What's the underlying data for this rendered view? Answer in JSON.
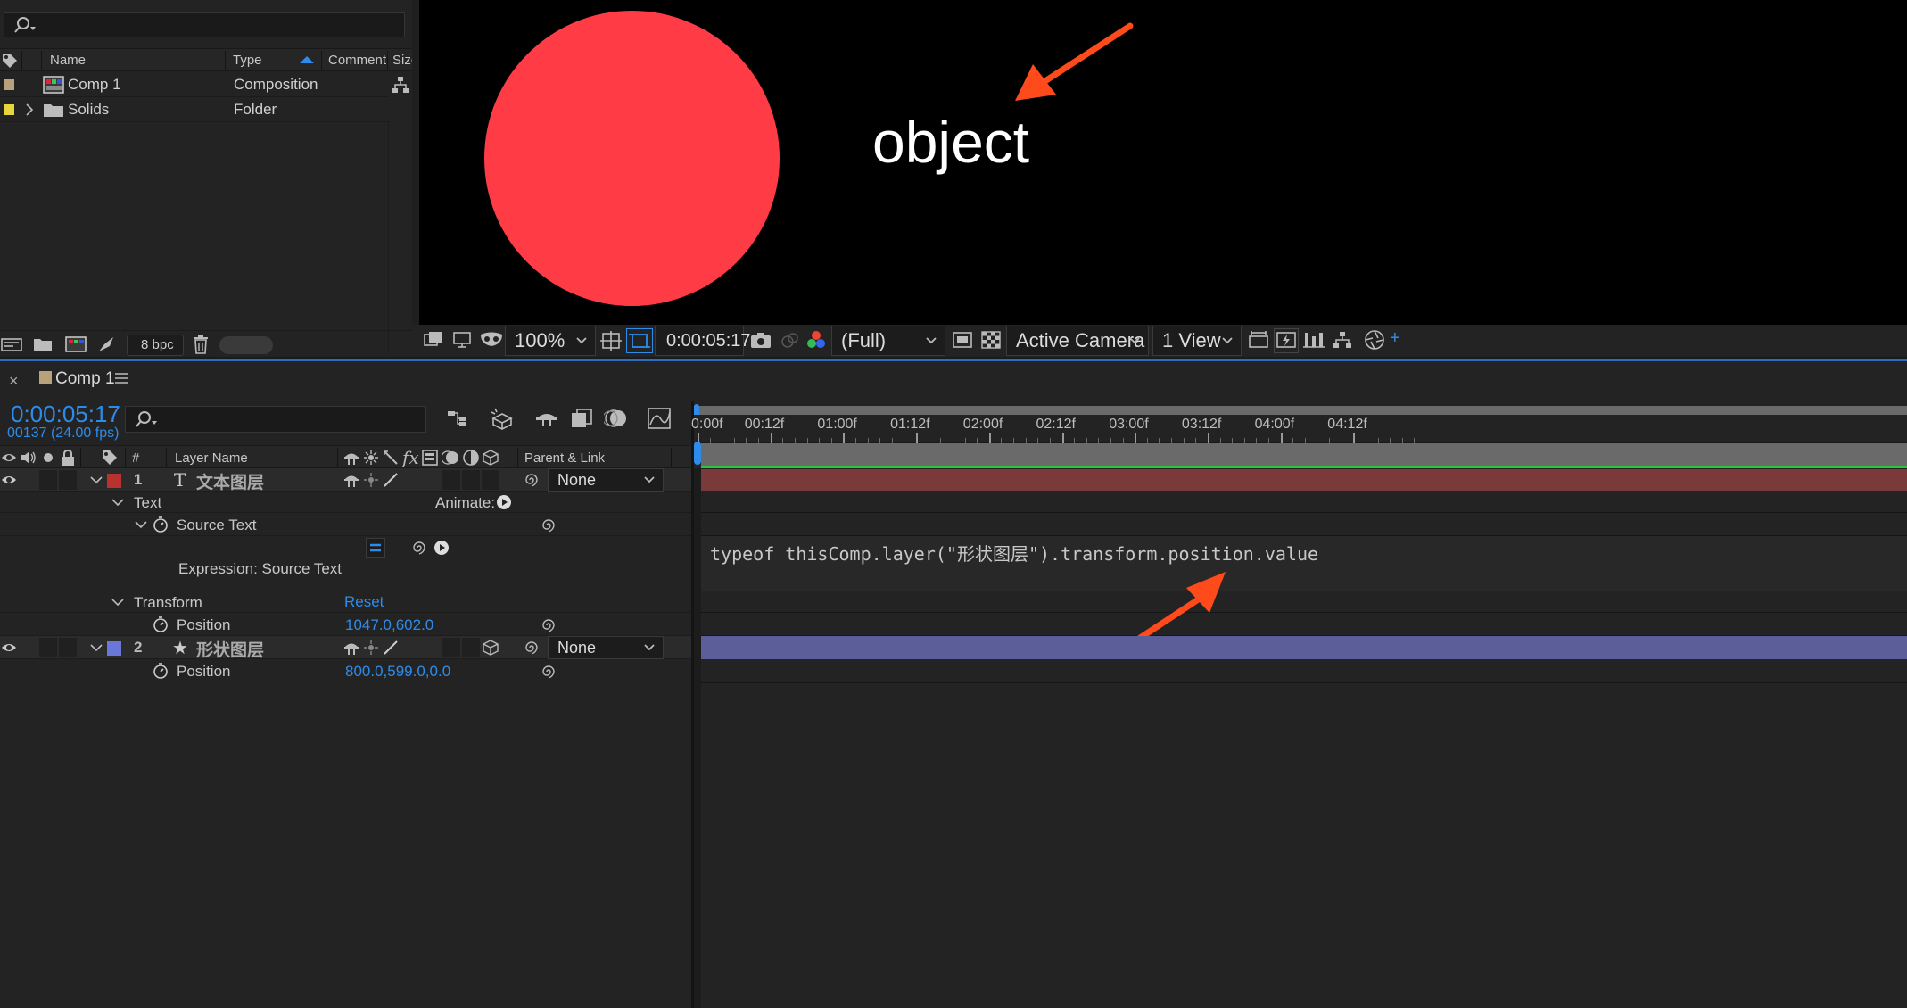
{
  "project": {
    "search_placeholder": "",
    "columns": {
      "name": "Name",
      "type": "Type",
      "comment": "Comment",
      "size": "Size"
    },
    "items": [
      {
        "name": "Comp 1",
        "type": "Composition",
        "label_color": "#b8a27c"
      },
      {
        "name": "Solids",
        "type": "Folder",
        "label_color": "#e6d83c"
      }
    ],
    "bpc": "8 bpc"
  },
  "viewer": {
    "circle_color": "#ff3c46",
    "arrow_color": "#ff4a1c",
    "overlay_text": "object",
    "zoom": "100%",
    "timecode": "0:00:05:17",
    "resolution": "(Full)",
    "camera": "Active Camera",
    "views": "1 View"
  },
  "timeline": {
    "tab_title": "Comp 1",
    "current_time": "0:00:05:17",
    "frame_info": "00137 (24.00 fps)",
    "search_placeholder": "",
    "col_hash": "#",
    "col_layer_name": "Layer Name",
    "col_parent": "Parent & Link",
    "ruler": [
      "0:00f",
      "00:12f",
      "01:00f",
      "01:12f",
      "02:00f",
      "02:12f",
      "03:00f",
      "03:12f",
      "04:00f",
      "04:12f"
    ],
    "layer1": {
      "num": "1",
      "type_icon": "T",
      "name": "文本图层",
      "parent": "None",
      "color": "#b8332f",
      "bar_color": "#7a3a3a"
    },
    "text_group": "Text",
    "animate_label": "Animate:",
    "source_text": "Source Text",
    "expression_label": "Expression: Source Text",
    "expression_code": "typeof thisComp.layer(\"形状图层\").transform.position.value",
    "transform_group": "Transform",
    "reset_label": "Reset",
    "position_label": "Position",
    "layer1_position": "1047.0,602.0",
    "layer2": {
      "num": "2",
      "type_icon": "★",
      "name": "形状图层",
      "parent": "None",
      "color": "#6b77d8",
      "bar_color": "#5b5e98"
    },
    "layer2_position": "800.0,599.0,0.0"
  }
}
